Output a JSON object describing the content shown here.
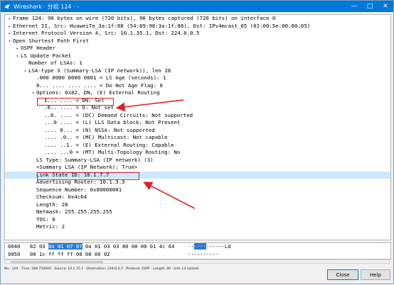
{
  "window": {
    "title": "Wireshark · 分组 124 · -"
  },
  "tree": [
    {
      "indent": 0,
      "twisty": "right",
      "text": "Frame 124: 90 bytes on wire (720 bits), 90 bytes captured (720 bits) on interface 0"
    },
    {
      "indent": 0,
      "twisty": "right",
      "text": "Ethernet II, Src: HuaweiTe_3a:1f:88 (54:89:98:3a:1f:88), Dst: IPv4mcast_05 (01:00:5e:00:00:05)"
    },
    {
      "indent": 0,
      "twisty": "right",
      "text": "Internet Protocol Version 4, Src: 10.1.35.1, Dst: 224.0.0.5"
    },
    {
      "indent": 0,
      "twisty": "down",
      "text": "Open Shortest Path First"
    },
    {
      "indent": 1,
      "twisty": "right",
      "text": "OSPF Header"
    },
    {
      "indent": 1,
      "twisty": "down",
      "text": "LS Update Packet"
    },
    {
      "indent": 2,
      "twisty": "",
      "text": "Number of LSAs: 1"
    },
    {
      "indent": 2,
      "twisty": "down",
      "text": "LSA-type 3 (Summary-LSA (IP network)), len 28"
    },
    {
      "indent": 3,
      "twisty": "",
      "text": ".000 0000 0000 0001 = LS Age (seconds): 1"
    },
    {
      "indent": 3,
      "twisty": "",
      "text": "0... .... .... .... = Do Not Age Flag: 0"
    },
    {
      "indent": 3,
      "twisty": "down",
      "text": "Options: 0x82, DN, (E) External Routing"
    },
    {
      "indent": 4,
      "twisty": "",
      "text": "1... .... = DN: Set"
    },
    {
      "indent": 4,
      "twisty": "",
      "text": ".0.. .... = O: Not set"
    },
    {
      "indent": 4,
      "twisty": "",
      "text": "..0. .... = (DC) Demand Circuits: Not supported"
    },
    {
      "indent": 4,
      "twisty": "",
      "text": "...0 .... = (L) LLS Data block: Not Present"
    },
    {
      "indent": 4,
      "twisty": "",
      "text": ".... 0... = (N) NSSA: Not supported"
    },
    {
      "indent": 4,
      "twisty": "",
      "text": ".... .0.. = (MC) Multicast: Not capable"
    },
    {
      "indent": 4,
      "twisty": "",
      "text": ".... ..1. = (E) External Routing: Capable"
    },
    {
      "indent": 4,
      "twisty": "",
      "text": ".... ...0 = (MT) Multi-Topology Routing: No"
    },
    {
      "indent": 3,
      "twisty": "",
      "text": "LS Type: Summary-LSA (IP network) (3)"
    },
    {
      "indent": 3,
      "twisty": "",
      "text": "<Summary LSA (IP Network): True>"
    },
    {
      "indent": 3,
      "twisty": "",
      "text": "Link State ID: 10.1.7.7",
      "highlight": true
    },
    {
      "indent": 3,
      "twisty": "",
      "text": "Advertising Router: 10.1.3.3"
    },
    {
      "indent": 3,
      "twisty": "",
      "text": "Sequence Number: 0x80000001"
    },
    {
      "indent": 3,
      "twisty": "",
      "text": "Checksum: 0x4c64"
    },
    {
      "indent": 3,
      "twisty": "",
      "text": "Length: 28"
    },
    {
      "indent": 3,
      "twisty": "",
      "text": "Netmask: 255.255.255.255"
    },
    {
      "indent": 3,
      "twisty": "",
      "text": "TOS: 0"
    },
    {
      "indent": 3,
      "twisty": "",
      "text": "Metric: 2"
    }
  ],
  "hex": [
    {
      "offset": "0040",
      "bytes_pre": "82 03 ",
      "bytes_sel": "0a 01 07 07",
      "bytes_post": " 0a 01  03 03 80 00 00 01 4c 64",
      "ascii_pre": "··",
      "ascii_sel": "····",
      "ascii_post": "······Ld"
    },
    {
      "offset": "0050",
      "bytes_pre": "00 1c ff ff ff 00 00 00  02",
      "bytes_sel": "",
      "bytes_post": "",
      "ascii_pre": "··········",
      "ascii_sel": "",
      "ascii_post": ""
    }
  ],
  "status": "No.: 124 · Time: 384.750000 · Source: 10.1.35.1 · Destination: 224.0.0.5 · Protocol: OSPF · Length: 90 · Info: LS Update",
  "buttons": {
    "close": "Close",
    "help": "Help"
  },
  "colors": {
    "accent": "#0078d7",
    "selection": "#cce8ff",
    "hex_selection": "#2b7bd6",
    "annotation": "#e02020"
  }
}
